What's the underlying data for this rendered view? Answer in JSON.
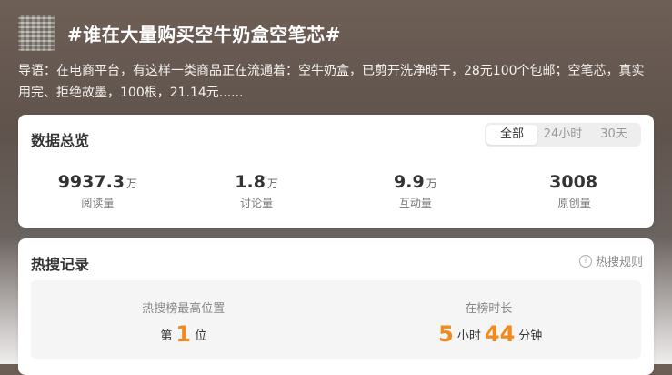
{
  "header": {
    "title": "#谁在大量购买空牛奶盒空笔芯#",
    "intro": "导语：在电商平台，有这样一类商品正在流通着：空牛奶盒，已剪开洗净晾干，28元100个包邮；空笔芯，真实用完、拒绝故墨，100根，21.14元......"
  },
  "overview": {
    "title": "数据总览",
    "tabs": [
      "全部",
      "24小时",
      "30天"
    ],
    "active_tab": "全部",
    "stats": [
      {
        "value": "9937.3",
        "unit": "万",
        "label": "阅读量"
      },
      {
        "value": "1.8",
        "unit": "万",
        "label": "讨论量"
      },
      {
        "value": "9.9",
        "unit": "万",
        "label": "互动量"
      },
      {
        "value": "3008",
        "unit": "",
        "label": "原创量"
      }
    ]
  },
  "hot_search": {
    "title": "热搜记录",
    "rules_label": "热搜规则",
    "peak": {
      "label": "热搜榜最高位置",
      "prefix": "第",
      "value": "1",
      "suffix": "位"
    },
    "duration": {
      "label": "在榜时长",
      "hours": "5",
      "hours_unit": "小时",
      "minutes": "44",
      "minutes_unit": "分钟"
    }
  },
  "colors": {
    "accent": "#f08a1d",
    "header_bg": "#6e5f56"
  }
}
